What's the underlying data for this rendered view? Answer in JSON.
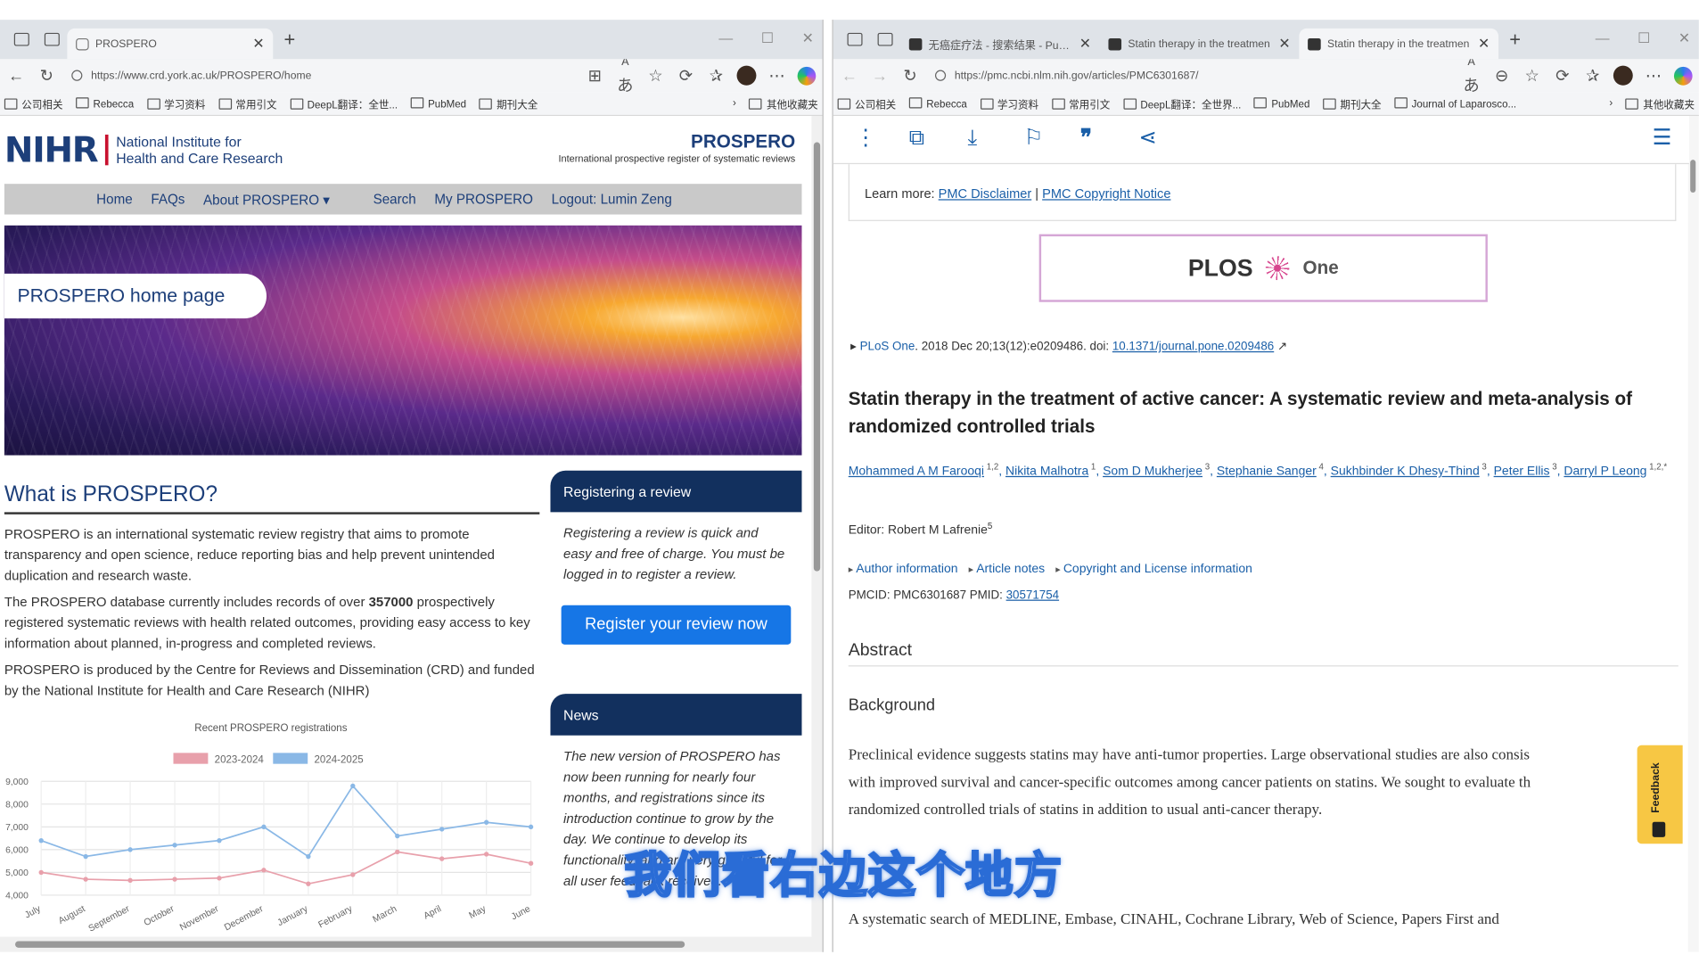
{
  "left_window": {
    "tab": {
      "title": "PROSPERO"
    },
    "url": "https://www.crd.york.ac.uk/PROSPERO/home",
    "bookmarks": [
      "公司相关",
      "Rebecca",
      "学习资料",
      "常用引文",
      "DeepL翻译：全世...",
      "PubMed",
      "期刊大全",
      "其他收藏夹"
    ],
    "header": {
      "logo": "NIHR",
      "org_line1": "National Institute for",
      "org_line2": "Health and Care Research",
      "site_title": "PROSPERO",
      "site_subtitle": "International prospective register of systematic reviews"
    },
    "nav": [
      "Home",
      "FAQs",
      "About PROSPERO ▾",
      "Search",
      "My PROSPERO",
      "Logout: Lumin Zeng"
    ],
    "hero_title": "PROSPERO home page",
    "what_is": {
      "heading": "What is PROSPERO?",
      "p1": "PROSPERO is an international systematic review registry that aims to promote transparency and open science, reduce reporting bias and help prevent unintended duplication and research waste.",
      "p2_pre": "The PROSPERO database currently includes records of over ",
      "p2_num": "357000",
      "p2_post": " prospectively registered systematic reviews with health related outcomes, providing easy access to key information about planned, in-progress and completed reviews.",
      "p3": "PROSPERO is produced by the Centre for Reviews and Dissemination (CRD) and funded by the National Institute for Health and Care Research (NIHR)"
    },
    "register": {
      "heading": "Registering a review",
      "text": "Registering a review is quick and easy and free of charge. You must be logged in to register a review.",
      "button": "Register your review now"
    },
    "news": {
      "heading": "News",
      "text": "The new version of PROSPERO has now been running for nearly four months, and registrations since its introduction continue to grow by the day. We continue to develop its functionality, and are very grateful for all user feedback received."
    }
  },
  "chart_data": {
    "type": "line",
    "title": "Recent PROSPERO registrations",
    "categories": [
      "July",
      "August",
      "September",
      "October",
      "November",
      "December",
      "January",
      "February",
      "March",
      "April",
      "May",
      "June"
    ],
    "series": [
      {
        "name": "2023-2024",
        "color": "#e8a0ab",
        "values": [
          5000,
          4700,
          4650,
          4700,
          4750,
          5100,
          4500,
          4900,
          5900,
          5600,
          5800,
          5400
        ]
      },
      {
        "name": "2024-2025",
        "color": "#8ab8e6",
        "values": [
          6400,
          5700,
          6000,
          6200,
          6400,
          7000,
          5700,
          8800,
          6600,
          6900,
          7200,
          7000
        ]
      }
    ],
    "ylim": [
      4000,
      9000
    ],
    "yticks": [
      "9,000",
      "8,000",
      "7,000",
      "6,000",
      "5,000",
      "4,000"
    ],
    "grid": true,
    "legend": "top"
  },
  "right_window": {
    "tabs": [
      "无癌症疗法 - 搜索结果 - PubM",
      "Statin therapy in the treatmen",
      "Statin therapy in the treatmen"
    ],
    "url": "https://pmc.ncbi.nlm.nih.gov/articles/PMC6301687/",
    "bookmarks": [
      "公司相关",
      "Rebecca",
      "学习资料",
      "常用引文",
      "DeepL翻译：全世界...",
      "PubMed",
      "期刊大全",
      "Journal of Laparosco...",
      "其他收藏夹"
    ],
    "disclaimer_label": "Learn more:",
    "disclaimer_links": [
      "PMC Disclaimer",
      "PMC Copyright Notice"
    ],
    "plos": {
      "name": "PLOS",
      "sub": "One"
    },
    "citation": {
      "journal": "PLoS One",
      "text": ". 2018 Dec 20;13(12):e0209486. doi: ",
      "doi": "10.1371/journal.pone.0209486"
    },
    "title": "Statin therapy in the treatment of active cancer: A systematic review and meta-analysis of randomized controlled trials",
    "authors": [
      {
        "name": "Mohammed A M Farooqi",
        "sup": "1,2"
      },
      {
        "name": "Nikita Malhotra",
        "sup": "1"
      },
      {
        "name": "Som D Mukherjee",
        "sup": "3"
      },
      {
        "name": "Stephanie Sanger",
        "sup": "4"
      },
      {
        "name": "Sukhbinder K Dhesy-Thind",
        "sup": "3"
      },
      {
        "name": "Peter Ellis",
        "sup": "3"
      },
      {
        "name": "Darryl P Leong",
        "sup": "1,2,*"
      }
    ],
    "editor": "Editor: Robert M Lafrenie",
    "editor_sup": "5",
    "meta_links": [
      "Author information",
      "Article notes",
      "Copyright and License information"
    ],
    "pmcid_label": "PMCID: PMC6301687  PMID: ",
    "pmid": "30571754",
    "abstract_heading": "Abstract",
    "background_heading": "Background",
    "background_lines": [
      "Preclinical evidence suggests statins may have anti-tumor properties. Large observational studies are also consis",
      "with improved survival and cancer-specific outcomes among cancer patients on statins. We sought to evaluate th",
      "randomized controlled trials of statins in addition to usual anti-cancer therapy."
    ],
    "methods_line": "A systematic search of MEDLINE, Embase, CINAHL, Cochrane Library, Web of Science, Papers First and",
    "feedback": "Feedback"
  },
  "subtitle": "我们看右边这个地方",
  "colors": {
    "nihr_blue": "#1d3f7a",
    "sidebar_navy": "#12305e",
    "register_blue": "#1676e6",
    "link_blue": "#1a5fa8",
    "feedback_yellow": "#f7c744"
  }
}
